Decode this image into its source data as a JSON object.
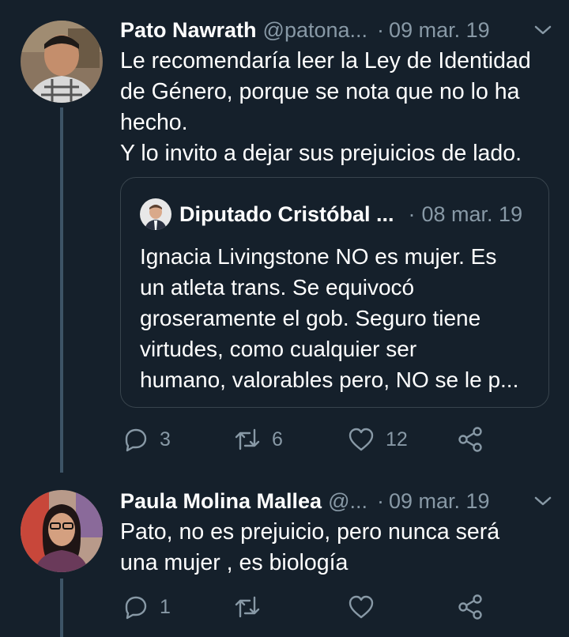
{
  "tweets": [
    {
      "name": "Pato Nawrath",
      "handle": "@patona...",
      "date": "09 mar. 19",
      "text_lines": [
        "Le recomendaría leer la Ley de Identidad",
        "de Género, porque se nota que no lo ha",
        "hecho.",
        "Y lo invito a dejar sus prejuicios de lado."
      ],
      "quote": {
        "name": "Diputado Cristóbal ...",
        "date": "08 mar. 19",
        "text_lines": [
          "Ignacia Livingstone NO es mujer. Es",
          "un atleta trans. Se equivocó",
          "groseramente el gob. Seguro tiene",
          "virtudes, como cualquier ser",
          "humano, valorables pero, NO se le p..."
        ]
      },
      "replies": "3",
      "retweets": "6",
      "likes": "12"
    },
    {
      "name": "Paula Molina Mallea",
      "handle": "@...",
      "date": "09 mar. 19",
      "text_lines": [
        "Pato, no es prejuicio, pero nunca será",
        "una mujer , es biología"
      ],
      "replies": "1",
      "retweets": "",
      "likes": ""
    }
  ],
  "icons": {
    "reply": "reply-icon",
    "retweet": "retweet-icon",
    "like": "heart-icon",
    "share": "share-icon",
    "caret": "chevron-down-icon"
  },
  "colors": {
    "background": "#15202b",
    "secondary_text": "#8899a6",
    "thread_line": "#3d5466",
    "border": "#38444d"
  }
}
